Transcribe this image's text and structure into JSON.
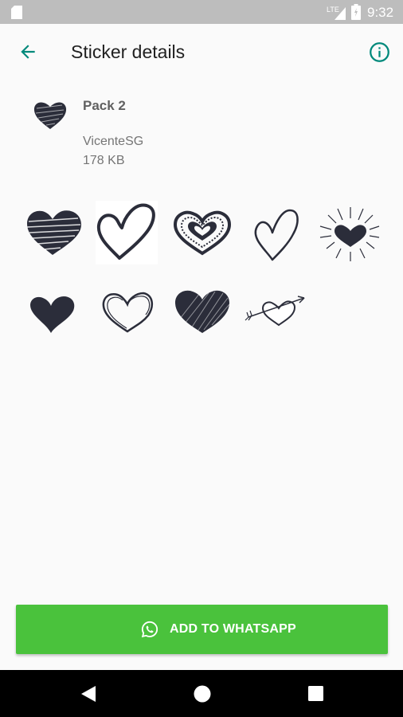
{
  "status_bar": {
    "time": "9:32",
    "icons": [
      "sd-card-icon",
      "signal-icon",
      "battery-icon"
    ]
  },
  "toolbar": {
    "title": "Sticker details",
    "back_icon": "arrow-back-icon",
    "info_icon": "info-icon"
  },
  "pack": {
    "name": "Pack 2",
    "publisher": "VicenteSG",
    "size": "178 KB"
  },
  "stickers": [
    "scribble-filled-heart",
    "outline-heart",
    "double-outline-heart",
    "thin-outline-heart",
    "radiant-heart",
    "solid-heart",
    "sketch-outline-heart",
    "hatched-heart",
    "arrow-heart"
  ],
  "add_button": {
    "label": "ADD TO WHATSAPP",
    "icon": "whatsapp-icon",
    "color": "#4ac23c"
  },
  "nav_bar": {
    "icons": [
      "nav-back-icon",
      "nav-home-icon",
      "nav-recents-icon"
    ]
  },
  "colors": {
    "accent": "#00897b",
    "heart": "#2b2d3a"
  }
}
